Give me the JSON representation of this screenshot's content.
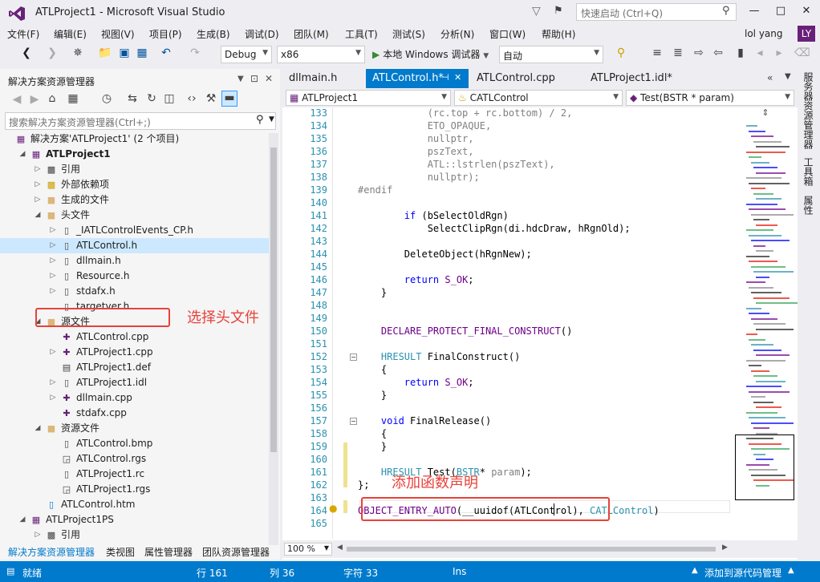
{
  "window": {
    "title": "ATLProject1 - Microsoft Visual Studio",
    "quick_launch_placeholder": "快速启动 (Ctrl+Q)",
    "min": "—",
    "max": "□",
    "close": "✕"
  },
  "menu": {
    "items": [
      "文件(F)",
      "编辑(E)",
      "视图(V)",
      "项目(P)",
      "生成(B)",
      "调试(D)",
      "团队(M)",
      "工具(T)",
      "测试(S)",
      "分析(N)",
      "窗口(W)",
      "帮助(H)"
    ],
    "user_name": "lol yang",
    "user_initials": "LY"
  },
  "toolbar": {
    "config": "Debug",
    "platform": "x86",
    "run_label": "本地 Windows 调试器",
    "run_mode": "自动"
  },
  "solution_explorer": {
    "title": "解决方案资源管理器",
    "pin": "⊡",
    "close": "✕",
    "search_placeholder": "搜索解决方案资源管理器(Ctrl+;)",
    "tree": [
      {
        "label": "解决方案'ATLProject1' (2 个项目)",
        "level": 0,
        "expander": "",
        "icon": "solution-icon"
      },
      {
        "label": "ATLProject1",
        "level": 1,
        "expander": "open",
        "icon": "project-icon",
        "bold": true
      },
      {
        "label": "引用",
        "level": 2,
        "expander": "closed",
        "icon": "references-icon"
      },
      {
        "label": "外部依赖项",
        "level": 2,
        "expander": "closed",
        "icon": "external-deps-icon"
      },
      {
        "label": "生成的文件",
        "level": 2,
        "expander": "closed",
        "icon": "folder-icon"
      },
      {
        "label": "头文件",
        "level": 2,
        "expander": "open",
        "icon": "folder-icon"
      },
      {
        "label": "_IATLControlEvents_CP.h",
        "level": 3,
        "expander": "closed",
        "icon": "header-file-icon"
      },
      {
        "label": "ATLControl.h",
        "level": 3,
        "expander": "closed",
        "icon": "header-file-icon",
        "selected": true
      },
      {
        "label": "dllmain.h",
        "level": 3,
        "expander": "closed",
        "icon": "header-file-icon"
      },
      {
        "label": "Resource.h",
        "level": 3,
        "expander": "closed",
        "icon": "header-file-icon"
      },
      {
        "label": "stdafx.h",
        "level": 3,
        "expander": "closed",
        "icon": "header-file-icon"
      },
      {
        "label": "targetver.h",
        "level": 3,
        "expander": "",
        "icon": "header-file-icon"
      },
      {
        "label": "源文件",
        "level": 2,
        "expander": "open",
        "icon": "folder-icon"
      },
      {
        "label": "ATLControl.cpp",
        "level": 3,
        "expander": "",
        "icon": "cpp-file-icon"
      },
      {
        "label": "ATLProject1.cpp",
        "level": 3,
        "expander": "closed",
        "icon": "cpp-file-icon"
      },
      {
        "label": "ATLProject1.def",
        "level": 3,
        "expander": "",
        "icon": "def-file-icon"
      },
      {
        "label": "ATLProject1.idl",
        "level": 3,
        "expander": "closed",
        "icon": "idl-file-icon"
      },
      {
        "label": "dllmain.cpp",
        "level": 3,
        "expander": "closed",
        "icon": "cpp-file-icon"
      },
      {
        "label": "stdafx.cpp",
        "level": 3,
        "expander": "",
        "icon": "cpp-file-icon"
      },
      {
        "label": "资源文件",
        "level": 2,
        "expander": "open",
        "icon": "folder-icon"
      },
      {
        "label": "ATLControl.bmp",
        "level": 3,
        "expander": "",
        "icon": "bitmap-file-icon"
      },
      {
        "label": "ATLControl.rgs",
        "level": 3,
        "expander": "",
        "icon": "rgs-file-icon"
      },
      {
        "label": "ATLProject1.rc",
        "level": 3,
        "expander": "",
        "icon": "rc-file-icon"
      },
      {
        "label": "ATLProject1.rgs",
        "level": 3,
        "expander": "",
        "icon": "rgs-file-icon"
      },
      {
        "label": "ATLControl.htm",
        "level": 2,
        "expander": "",
        "icon": "html-file-icon"
      },
      {
        "label": "ATLProject1PS",
        "level": 1,
        "expander": "open",
        "icon": "project-icon"
      },
      {
        "label": "引用",
        "level": 2,
        "expander": "closed",
        "icon": "references-icon"
      }
    ],
    "bottom_tabs": [
      "解决方案资源管理器",
      "类视图",
      "属性管理器",
      "团队资源管理器"
    ],
    "annotation": "选择头文件"
  },
  "editor": {
    "tabs": [
      {
        "label": "dllmain.h",
        "active": false
      },
      {
        "label": "ATLControl.h*",
        "active": true,
        "pin": "⊣",
        "close": "✕"
      },
      {
        "label": "ATLControl.cpp",
        "active": false
      },
      {
        "label": "ATLProject1.idl*",
        "active": false
      }
    ],
    "overflow": "«",
    "nav_project": "ATLProject1",
    "nav_class": "CATLControl",
    "nav_member": "Test(BSTR * param)",
    "zoom": "100 %",
    "annotation": "添加函数声明",
    "lines": [
      {
        "n": "133",
        "t": "            (rc.top + rc.bottom) / 2,"
      },
      {
        "n": "134",
        "t": "            ETO_OPAQUE,"
      },
      {
        "n": "135",
        "t": "            nullptr,"
      },
      {
        "n": "136",
        "t": "            pszText,"
      },
      {
        "n": "137",
        "t": "            ATL::lstrlen(pszText),"
      },
      {
        "n": "138",
        "t": "            nullptr);"
      },
      {
        "n": "139",
        "t": "#endif"
      },
      {
        "n": "140",
        "t": ""
      },
      {
        "n": "141",
        "t": "        if (bSelectOldRgn)"
      },
      {
        "n": "142",
        "t": "            SelectClipRgn(di.hdcDraw, hRgnOld);"
      },
      {
        "n": "143",
        "t": ""
      },
      {
        "n": "144",
        "t": "        DeleteObject(hRgnNew);"
      },
      {
        "n": "145",
        "t": ""
      },
      {
        "n": "146",
        "t": "        return S_OK;"
      },
      {
        "n": "147",
        "t": "    }"
      },
      {
        "n": "148",
        "t": ""
      },
      {
        "n": "149",
        "t": ""
      },
      {
        "n": "150",
        "t": "    DECLARE_PROTECT_FINAL_CONSTRUCT()"
      },
      {
        "n": "151",
        "t": ""
      },
      {
        "n": "152",
        "t": "    HRESULT FinalConstruct()"
      },
      {
        "n": "153",
        "t": "    {"
      },
      {
        "n": "154",
        "t": "        return S_OK;"
      },
      {
        "n": "155",
        "t": "    }"
      },
      {
        "n": "156",
        "t": ""
      },
      {
        "n": "157",
        "t": "    void FinalRelease()"
      },
      {
        "n": "158",
        "t": "    {"
      },
      {
        "n": "159",
        "t": "    }"
      },
      {
        "n": "160",
        "t": ""
      },
      {
        "n": "161",
        "t": "    HRESULT Test(BSTR* param);"
      },
      {
        "n": "162",
        "t": "};"
      },
      {
        "n": "163",
        "t": ""
      },
      {
        "n": "164",
        "t": "OBJECT_ENTRY_AUTO(__uuidof(ATLControl), CATLControl)"
      },
      {
        "n": "165",
        "t": ""
      }
    ]
  },
  "right_rail": [
    "服务器资源管理器",
    "工具箱",
    "属性"
  ],
  "status": {
    "ready": "就绪",
    "line": "行 161",
    "col": "列 36",
    "char": "字符 33",
    "mode": "Ins",
    "source_control": "添加到源代码管理"
  },
  "colors": {
    "accent": "#007acc",
    "annotation": "#e8413a",
    "keyword": "#0000ff",
    "type": "#2b91af",
    "macro": "#6f008a"
  }
}
